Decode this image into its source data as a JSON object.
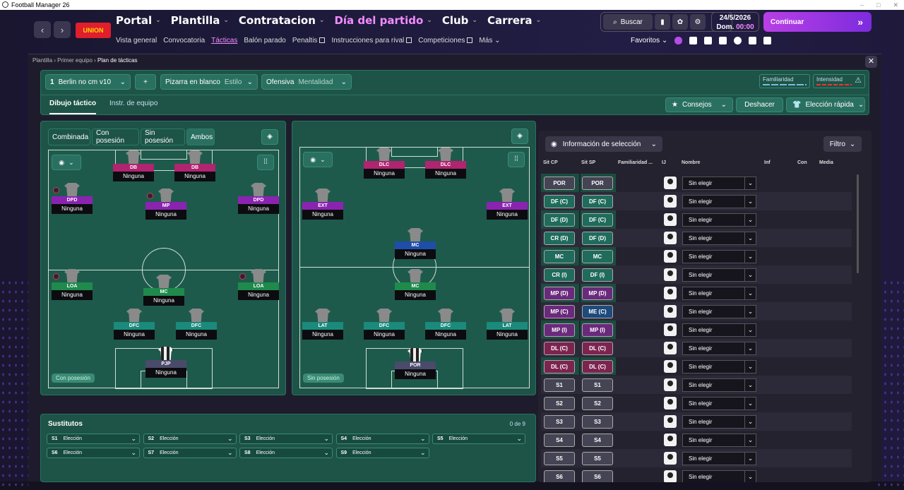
{
  "window": {
    "title": "Football Manager 26",
    "controls": [
      "–",
      "□",
      "✕"
    ]
  },
  "nav": {
    "back": "‹",
    "fwd": "›",
    "club_logo_text": "UNION",
    "menu": [
      {
        "label": "Portal",
        "active": false
      },
      {
        "label": "Plantilla",
        "active": false
      },
      {
        "label": "Contratacion",
        "active": false
      },
      {
        "label": "Día del partido",
        "active": true
      },
      {
        "label": "Club",
        "active": false
      },
      {
        "label": "Carrera",
        "active": false
      }
    ],
    "submenu": [
      {
        "label": "Vista general"
      },
      {
        "label": "Convocatoria"
      },
      {
        "label": "Tácticas",
        "active": true
      },
      {
        "label": "Balón parado"
      },
      {
        "label": "Penaltis",
        "external": true
      },
      {
        "label": "Instrucciones para rival",
        "external": true
      },
      {
        "label": "Competiciones",
        "external": true
      },
      {
        "label": "Más"
      }
    ],
    "search_label": "Buscar",
    "date": "24/5/2026",
    "day": "Dom.",
    "time": "00:00",
    "continue_label": "Continuar",
    "favorites_label": "Favoritos"
  },
  "breadcrumb": {
    "items": [
      "Plantilla",
      "Primer equipo"
    ],
    "current": "Plan de tácticas"
  },
  "tactic": {
    "number": "1",
    "name": "Berlin no cm v10",
    "add": "+",
    "style_value": "Pizarra en blanco",
    "style_label": "Estilo",
    "mentality_value": "Ofensiva",
    "mentality_label": "Mentalidad",
    "familiarity_label": "Familiaridad",
    "intensity_label": "Intensidad"
  },
  "tabs": {
    "t1": "Dibujo táctico",
    "t2": "Instr. de equipo"
  },
  "actions": {
    "advice": "Consejos",
    "undo": "Deshacer",
    "quick": "Elección rápida"
  },
  "phase_tabs": [
    "Combinada",
    "Con posesión",
    "Sin posesión",
    "Ambos"
  ],
  "pitch_left": {
    "label": "Con posesión",
    "players": [
      {
        "role": "DB",
        "name": "Ninguna",
        "color": "#b02470"
      },
      {
        "role": "DB",
        "name": "Ninguna",
        "color": "#b02470"
      },
      {
        "role": "DPD",
        "name": "Ninguna",
        "color": "#8a24b0"
      },
      {
        "role": "MP",
        "name": "Ninguna",
        "color": "#8a24b0"
      },
      {
        "role": "DPD",
        "name": "Ninguna",
        "color": "#8a24b0"
      },
      {
        "role": "LOA",
        "name": "Ninguna",
        "color": "#1f8a4c"
      },
      {
        "role": "MC",
        "name": "Ninguna",
        "color": "#1f8a4c"
      },
      {
        "role": "LOA",
        "name": "Ninguna",
        "color": "#1f8a4c"
      },
      {
        "role": "DFC",
        "name": "Ninguna",
        "color": "#1a8a7c"
      },
      {
        "role": "DFC",
        "name": "Ninguna",
        "color": "#1a8a7c"
      },
      {
        "role": "PJP",
        "name": "Ninguna",
        "color": "#4a4a6a"
      }
    ]
  },
  "pitch_right": {
    "label": "Sin posesión",
    "players": [
      {
        "role": "DLC",
        "name": "Ninguna",
        "color": "#b02470"
      },
      {
        "role": "DLC",
        "name": "Ninguna",
        "color": "#b02470"
      },
      {
        "role": "EXT",
        "name": "Ninguna",
        "color": "#8a24b0"
      },
      {
        "role": "EXT",
        "name": "Ninguna",
        "color": "#8a24b0"
      },
      {
        "role": "MC",
        "name": "Ninguna",
        "color": "#1e4ea8"
      },
      {
        "role": "MC",
        "name": "Ninguna",
        "color": "#1f8a4c"
      },
      {
        "role": "LAT",
        "name": "Ninguna",
        "color": "#1a8a7c"
      },
      {
        "role": "DFC",
        "name": "Ninguna",
        "color": "#1a8a7c"
      },
      {
        "role": "DFC",
        "name": "Ninguna",
        "color": "#1a8a7c"
      },
      {
        "role": "LAT",
        "name": "Ninguna",
        "color": "#1a8a7c"
      },
      {
        "role": "POR",
        "name": "Ninguna",
        "color": "#4a4a6a"
      }
    ]
  },
  "substitutes": {
    "title": "Sustitutos",
    "count": "0 de 9",
    "choice": "Elección",
    "slots": [
      "S1",
      "S2",
      "S3",
      "S4",
      "S5",
      "S6",
      "S7",
      "S8",
      "S9"
    ]
  },
  "selection": {
    "info_label": "Información de selección",
    "filter_label": "Filtro",
    "headers": {
      "cp": "Sit CP",
      "sp": "Sit SP",
      "fam": "Familiaridad ...",
      "ij": "IJ",
      "name": "Nombre",
      "inf": "Inf",
      "con": "Con",
      "media": "Media"
    },
    "placeholder": "Sin elegir",
    "rows": [
      {
        "cp": "POR",
        "sp": "POR",
        "c1": "#444454",
        "c2": "#444454"
      },
      {
        "cp": "DF (C)",
        "sp": "DF (C)",
        "c1": "#1f6b5c",
        "c2": "#1f6b5c"
      },
      {
        "cp": "DF (D)",
        "sp": "DF (C)",
        "c1": "#1f6b5c",
        "c2": "#1f6b5c"
      },
      {
        "cp": "CR (D)",
        "sp": "DF (D)",
        "c1": "#1f6b5c",
        "c2": "#1f6b5c"
      },
      {
        "cp": "MC",
        "sp": "MC",
        "c1": "#1f6b5c",
        "c2": "#1f6b5c"
      },
      {
        "cp": "CR (I)",
        "sp": "DF (I)",
        "c1": "#1f6b5c",
        "c2": "#1f6b5c"
      },
      {
        "cp": "MP (D)",
        "sp": "MP (D)",
        "c1": "#6a2a7c",
        "c2": "#6a2a7c"
      },
      {
        "cp": "MP (C)",
        "sp": "ME (C)",
        "c1": "#6a2a7c",
        "c2": "#1e4a7c"
      },
      {
        "cp": "MP (I)",
        "sp": "MP (I)",
        "c1": "#6a2a7c",
        "c2": "#6a2a7c"
      },
      {
        "cp": "DL (C)",
        "sp": "DL (C)",
        "c1": "#7c2450",
        "c2": "#7c2450"
      },
      {
        "cp": "DL (C)",
        "sp": "DL (C)",
        "c1": "#7c2450",
        "c2": "#7c2450"
      },
      {
        "cp": "S1",
        "sp": "S1",
        "c1": "#444454",
        "c2": "#444454"
      },
      {
        "cp": "S2",
        "sp": "S2",
        "c1": "#444454",
        "c2": "#444454"
      },
      {
        "cp": "S3",
        "sp": "S3",
        "c1": "#444454",
        "c2": "#444454"
      },
      {
        "cp": "S4",
        "sp": "S4",
        "c1": "#444454",
        "c2": "#444454"
      },
      {
        "cp": "S5",
        "sp": "S5",
        "c1": "#444454",
        "c2": "#444454"
      },
      {
        "cp": "S6",
        "sp": "S6",
        "c1": "#444454",
        "c2": "#444454"
      }
    ]
  }
}
